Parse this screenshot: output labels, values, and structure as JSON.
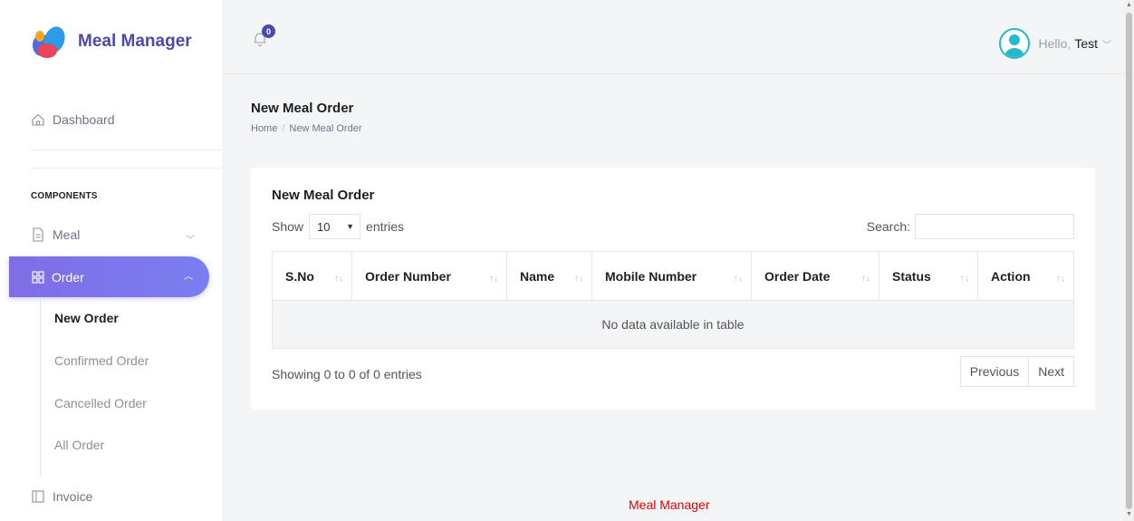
{
  "brand": {
    "name": "Meal Manager",
    "logo_colors": [
      "#e8445a",
      "#f7a823",
      "#4b6de8",
      "#2f9be8"
    ]
  },
  "sidebar": {
    "dashboard": "Dashboard",
    "section_title": "COMPONENTS",
    "meal": "Meal",
    "order": "Order",
    "order_sub": [
      "New Order",
      "Confirmed Order",
      "Cancelled Order",
      "All Order"
    ],
    "invoice": "Invoice"
  },
  "topbar": {
    "notification_count": "0",
    "greeting": "Hello,",
    "user_name": "Test"
  },
  "page": {
    "title": "New Meal Order",
    "breadcrumb": [
      "Home",
      "New Meal Order"
    ]
  },
  "card": {
    "title": "New Meal Order",
    "show_label": "Show",
    "entries_value": "10",
    "entries_label": "entries",
    "search_label": "Search:",
    "columns": [
      "S.No",
      "Order Number",
      "Name",
      "Mobile Number",
      "Order Date",
      "Status",
      "Action"
    ],
    "empty_text": "No data available in table",
    "info": "Showing 0 to 0 of 0 entries",
    "prev": "Previous",
    "next": "Next"
  },
  "footer": "Meal Manager",
  "colors": {
    "accent": "#4b49ac",
    "active_gradient_start": "#7f6de6",
    "footer_text": "#e00000"
  }
}
